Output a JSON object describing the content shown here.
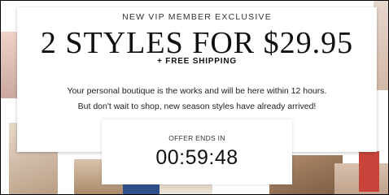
{
  "promo": {
    "eyebrow": "NEW VIP MEMBER EXCLUSIVE",
    "headline": "2 STYLES FOR $29.95",
    "subheadline": "+ FREE SHIPPING",
    "message_line1": "Your personal boutique is the works and will be here within 12 hours.",
    "message_line2": "But don't wait to shop, new season styles have already arrived!"
  },
  "timer": {
    "label": "OFFER ENDS IN",
    "value": "00:59:48"
  }
}
